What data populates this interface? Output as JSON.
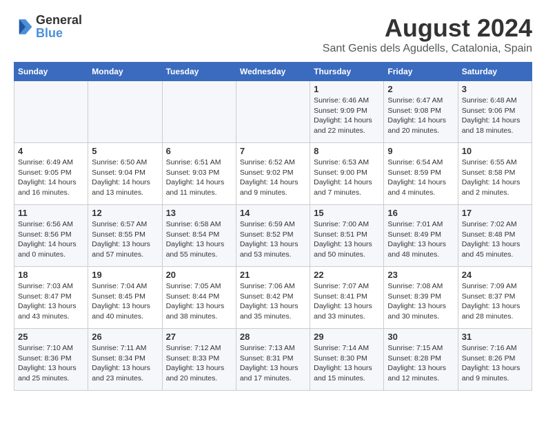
{
  "header": {
    "logo_general": "General",
    "logo_blue": "Blue",
    "main_title": "August 2024",
    "subtitle": "Sant Genis dels Agudells, Catalonia, Spain"
  },
  "calendar": {
    "days_of_week": [
      "Sunday",
      "Monday",
      "Tuesday",
      "Wednesday",
      "Thursday",
      "Friday",
      "Saturday"
    ],
    "weeks": [
      [
        {
          "day": "",
          "info": ""
        },
        {
          "day": "",
          "info": ""
        },
        {
          "day": "",
          "info": ""
        },
        {
          "day": "",
          "info": ""
        },
        {
          "day": "1",
          "info": "Sunrise: 6:46 AM\nSunset: 9:09 PM\nDaylight: 14 hours and 22 minutes."
        },
        {
          "day": "2",
          "info": "Sunrise: 6:47 AM\nSunset: 9:08 PM\nDaylight: 14 hours and 20 minutes."
        },
        {
          "day": "3",
          "info": "Sunrise: 6:48 AM\nSunset: 9:06 PM\nDaylight: 14 hours and 18 minutes."
        }
      ],
      [
        {
          "day": "4",
          "info": "Sunrise: 6:49 AM\nSunset: 9:05 PM\nDaylight: 14 hours and 16 minutes."
        },
        {
          "day": "5",
          "info": "Sunrise: 6:50 AM\nSunset: 9:04 PM\nDaylight: 14 hours and 13 minutes."
        },
        {
          "day": "6",
          "info": "Sunrise: 6:51 AM\nSunset: 9:03 PM\nDaylight: 14 hours and 11 minutes."
        },
        {
          "day": "7",
          "info": "Sunrise: 6:52 AM\nSunset: 9:02 PM\nDaylight: 14 hours and 9 minutes."
        },
        {
          "day": "8",
          "info": "Sunrise: 6:53 AM\nSunset: 9:00 PM\nDaylight: 14 hours and 7 minutes."
        },
        {
          "day": "9",
          "info": "Sunrise: 6:54 AM\nSunset: 8:59 PM\nDaylight: 14 hours and 4 minutes."
        },
        {
          "day": "10",
          "info": "Sunrise: 6:55 AM\nSunset: 8:58 PM\nDaylight: 14 hours and 2 minutes."
        }
      ],
      [
        {
          "day": "11",
          "info": "Sunrise: 6:56 AM\nSunset: 8:56 PM\nDaylight: 14 hours and 0 minutes."
        },
        {
          "day": "12",
          "info": "Sunrise: 6:57 AM\nSunset: 8:55 PM\nDaylight: 13 hours and 57 minutes."
        },
        {
          "day": "13",
          "info": "Sunrise: 6:58 AM\nSunset: 8:54 PM\nDaylight: 13 hours and 55 minutes."
        },
        {
          "day": "14",
          "info": "Sunrise: 6:59 AM\nSunset: 8:52 PM\nDaylight: 13 hours and 53 minutes."
        },
        {
          "day": "15",
          "info": "Sunrise: 7:00 AM\nSunset: 8:51 PM\nDaylight: 13 hours and 50 minutes."
        },
        {
          "day": "16",
          "info": "Sunrise: 7:01 AM\nSunset: 8:49 PM\nDaylight: 13 hours and 48 minutes."
        },
        {
          "day": "17",
          "info": "Sunrise: 7:02 AM\nSunset: 8:48 PM\nDaylight: 13 hours and 45 minutes."
        }
      ],
      [
        {
          "day": "18",
          "info": "Sunrise: 7:03 AM\nSunset: 8:47 PM\nDaylight: 13 hours and 43 minutes."
        },
        {
          "day": "19",
          "info": "Sunrise: 7:04 AM\nSunset: 8:45 PM\nDaylight: 13 hours and 40 minutes."
        },
        {
          "day": "20",
          "info": "Sunrise: 7:05 AM\nSunset: 8:44 PM\nDaylight: 13 hours and 38 minutes."
        },
        {
          "day": "21",
          "info": "Sunrise: 7:06 AM\nSunset: 8:42 PM\nDaylight: 13 hours and 35 minutes."
        },
        {
          "day": "22",
          "info": "Sunrise: 7:07 AM\nSunset: 8:41 PM\nDaylight: 13 hours and 33 minutes."
        },
        {
          "day": "23",
          "info": "Sunrise: 7:08 AM\nSunset: 8:39 PM\nDaylight: 13 hours and 30 minutes."
        },
        {
          "day": "24",
          "info": "Sunrise: 7:09 AM\nSunset: 8:37 PM\nDaylight: 13 hours and 28 minutes."
        }
      ],
      [
        {
          "day": "25",
          "info": "Sunrise: 7:10 AM\nSunset: 8:36 PM\nDaylight: 13 hours and 25 minutes."
        },
        {
          "day": "26",
          "info": "Sunrise: 7:11 AM\nSunset: 8:34 PM\nDaylight: 13 hours and 23 minutes."
        },
        {
          "day": "27",
          "info": "Sunrise: 7:12 AM\nSunset: 8:33 PM\nDaylight: 13 hours and 20 minutes."
        },
        {
          "day": "28",
          "info": "Sunrise: 7:13 AM\nSunset: 8:31 PM\nDaylight: 13 hours and 17 minutes."
        },
        {
          "day": "29",
          "info": "Sunrise: 7:14 AM\nSunset: 8:30 PM\nDaylight: 13 hours and 15 minutes."
        },
        {
          "day": "30",
          "info": "Sunrise: 7:15 AM\nSunset: 8:28 PM\nDaylight: 13 hours and 12 minutes."
        },
        {
          "day": "31",
          "info": "Sunrise: 7:16 AM\nSunset: 8:26 PM\nDaylight: 13 hours and 9 minutes."
        }
      ]
    ]
  }
}
